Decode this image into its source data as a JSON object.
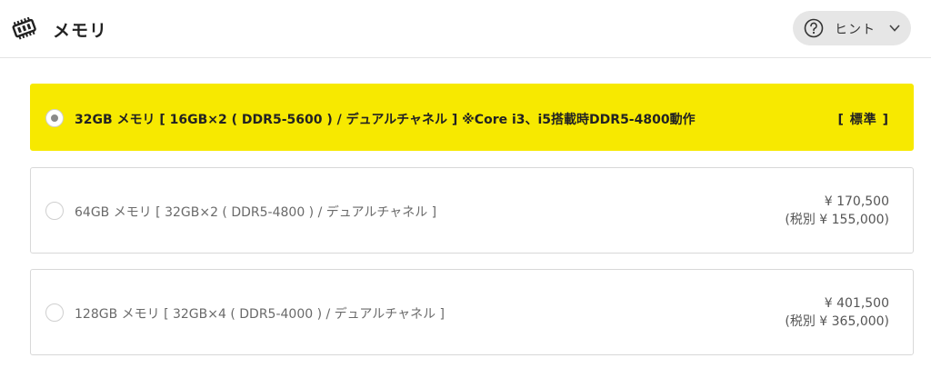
{
  "header": {
    "title": "メモリ",
    "icon": "memory-chip-icon",
    "hint_button": {
      "label": "ヒント",
      "icon": "question-circle-icon",
      "chevron": "chevron-down-icon"
    }
  },
  "options": [
    {
      "label": "32GB メモリ [ 16GB×2 ( DDR5-5600 ) / デュアルチャネル ] ※Core i3、i5搭載時DDR5-4800動作",
      "badge": "[ 標準 ]",
      "selected": true
    },
    {
      "label": "64GB メモリ [ 32GB×2 ( DDR5-4800 ) / デュアルチャネル ]",
      "price": "¥ 170,500",
      "price_tax_excluded": "(税別 ¥ 155,000)",
      "selected": false
    },
    {
      "label": "128GB メモリ [ 32GB×4 ( DDR5-4000 ) / デュアルチャネル ]",
      "price": "¥ 401,500",
      "price_tax_excluded": "(税別 ¥ 365,000)",
      "selected": false
    }
  ],
  "colors": {
    "selected_background": "#f7e900",
    "border": "#d8d8d8",
    "hint_background": "#e6e6e6"
  }
}
